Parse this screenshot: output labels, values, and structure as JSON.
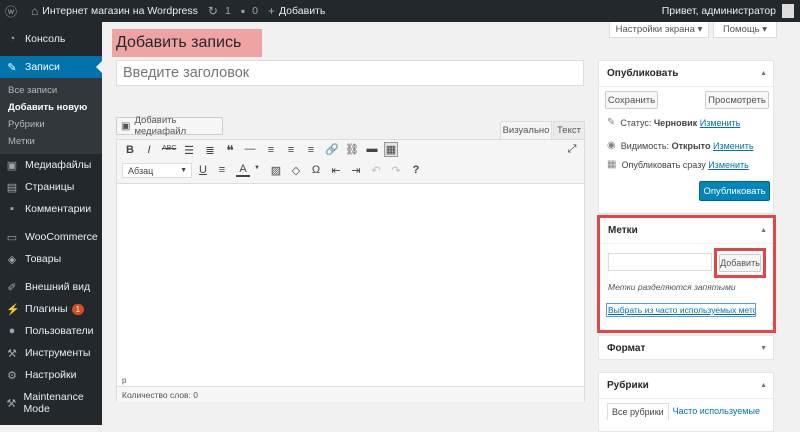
{
  "adminbar": {
    "site_name": "Интернет магазин на Wordpress",
    "updates_count": "1",
    "comments_count": "0",
    "new_label": "Добавить",
    "greeting": "Привет, администратор"
  },
  "sidebar": {
    "items": [
      {
        "label": "Консоль",
        "icon": "dashboard-icon"
      },
      {
        "label": "Записи",
        "icon": "pin-icon",
        "active": true
      },
      {
        "label": "Медиафайлы",
        "icon": "media-icon"
      },
      {
        "label": "Страницы",
        "icon": "page-icon"
      },
      {
        "label": "Комментарии",
        "icon": "comment-icon"
      },
      {
        "label": "WooCommerce",
        "icon": "woocommerce-icon"
      },
      {
        "label": "Товары",
        "icon": "products-icon"
      },
      {
        "label": "Внешний вид",
        "icon": "appearance-icon"
      },
      {
        "label": "Плагины",
        "icon": "plugins-icon",
        "badge": "1"
      },
      {
        "label": "Пользователи",
        "icon": "users-icon"
      },
      {
        "label": "Инструменты",
        "icon": "tools-icon"
      },
      {
        "label": "Настройки",
        "icon": "settings-icon"
      },
      {
        "label": "Maintenance Mode",
        "icon": "maintenance-icon"
      }
    ],
    "submenu": [
      "Все записи",
      "Добавить новую",
      "Рубрики",
      "Метки"
    ]
  },
  "header": {
    "screen_options": "Настройки экрана",
    "help": "Помощь",
    "page_title": "Добавить запись"
  },
  "editor": {
    "title_placeholder": "Введите заголовок",
    "media_button": "Добавить медиафайл",
    "tab_visual": "Визуально",
    "tab_text": "Текст",
    "format_select": "Абзац",
    "path": "p",
    "word_count": "Количество слов: 0"
  },
  "publish_box": {
    "title": "Опубликовать",
    "save_draft": "Сохранить",
    "preview": "Просмотреть",
    "status_label": "Статус:",
    "status_value": "Черновик",
    "visibility_label": "Видимость:",
    "visibility_value": "Открыто",
    "publish_time": "Опубликовать сразу",
    "edit_link": "Изменить",
    "publish_button": "Опубликовать"
  },
  "tags_box": {
    "title": "Метки",
    "add_button": "Добавить",
    "hint": "Метки разделяются запятыми",
    "popular_link": "Выбрать из часто используемых меток"
  },
  "format_box": {
    "title": "Формат"
  },
  "categories_box": {
    "title": "Рубрики",
    "tab_all": "Все рубрики",
    "tab_popular": "Часто используемые"
  },
  "colors": {
    "accent": "#0073aa",
    "admin_bar": "#23282d",
    "highlight": "#e04848",
    "title_bg": "#f0a3a3"
  }
}
